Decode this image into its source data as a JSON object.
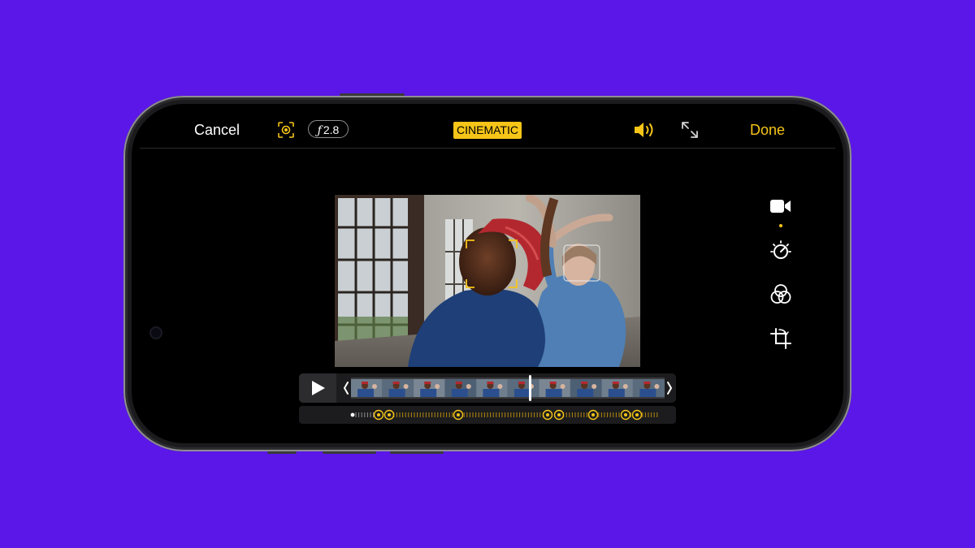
{
  "topbar": {
    "cancel_label": "Cancel",
    "aperture_prefix": "ƒ",
    "aperture_value": "2.8",
    "mode_label": "CINEMATIC",
    "done_label": "Done"
  },
  "icons": {
    "focus": "focus-lock-icon",
    "speaker": "speaker-icon",
    "expand": "expand-icon",
    "play": "play-icon"
  },
  "sidebar": {
    "tools": [
      "video-camera-icon",
      "adjust-dial-icon",
      "filters-icon",
      "crop-rotate-icon"
    ],
    "selected_tool": "video-camera-icon"
  },
  "timeline": {
    "playhead_position": 0.57
  },
  "colors": {
    "background": "#5b17e8",
    "accent": "#f6c518",
    "screen": "#000000"
  }
}
